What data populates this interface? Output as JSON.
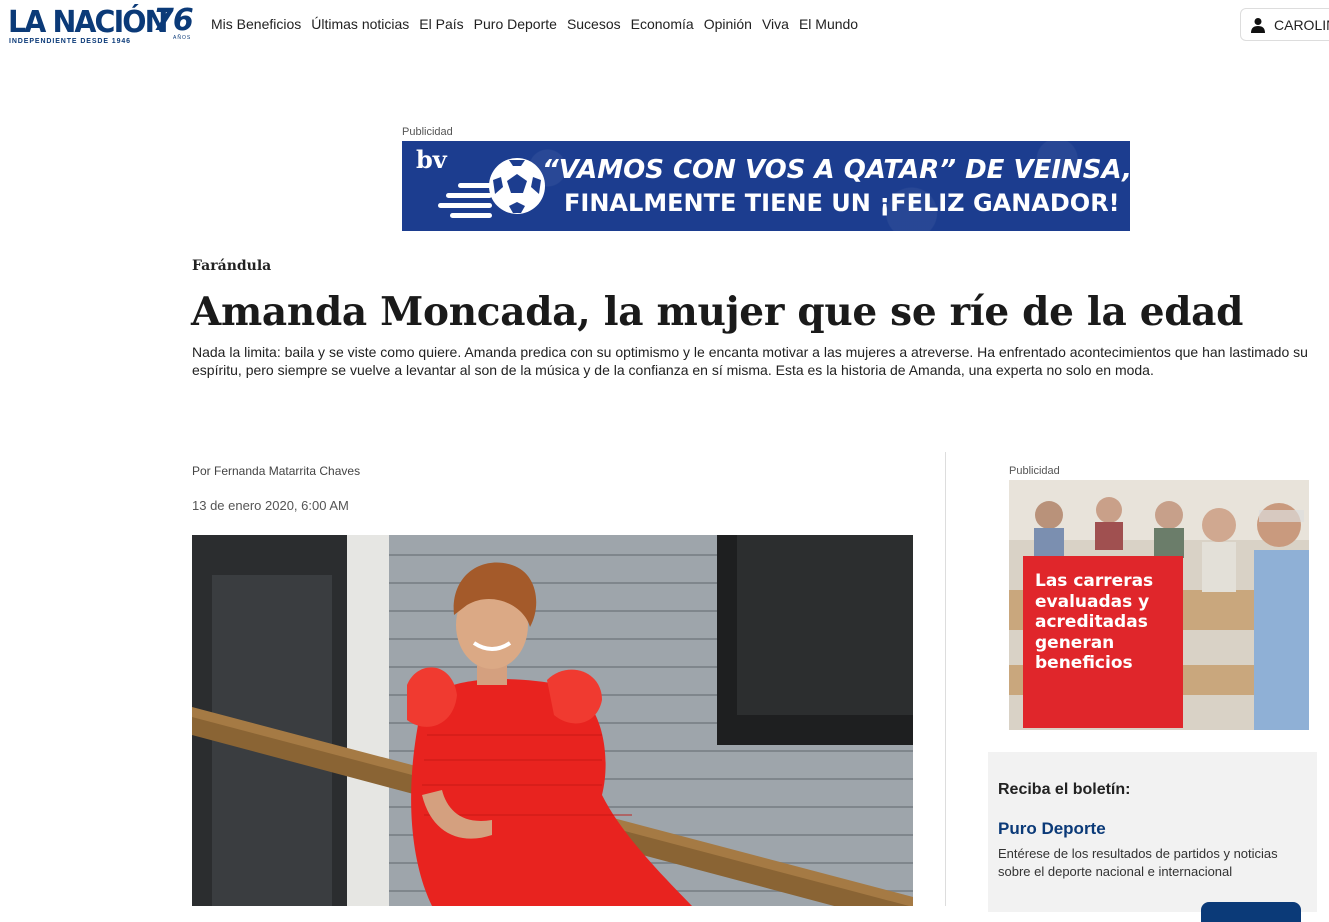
{
  "header": {
    "logo": {
      "brand": "LA NACIÓN",
      "anniversary": "76",
      "years_label": "AÑOS",
      "tagline": "INDEPENDIENTE DESDE 1946"
    },
    "nav": [
      "Mis Beneficios",
      "Últimas noticias",
      "El País",
      "Puro Deporte",
      "Sucesos",
      "Economía",
      "Opinión",
      "Viva",
      "El Mundo"
    ],
    "user": {
      "name": "CAROLIN",
      "icon": "user-icon"
    }
  },
  "top_ad": {
    "label": "Publicidad",
    "brand": "bv",
    "line1": "“VAMOS CON VOS A QATAR” DE VEINSA,",
    "line2": "FINALMENTE TIENE UN ¡FELIZ GANADOR!",
    "colors": {
      "background": "#1c3d8f",
      "text": "#ffffff"
    }
  },
  "article": {
    "section": "Farándula",
    "headline": "Amanda Moncada, la mujer que se ríe de la edad",
    "summary": "Nada la limita: baila y se viste como quiere. Amanda predica con su optimismo y le encanta motivar a las mujeres a atreverse. Ha enfrentado acontecimientos que han lastimado su espíritu, pero siempre se vuelve a levantar al son de la música y de la confianza en sí misma. Esta es la historia de Amanda, una experta no solo en moda.",
    "byline": "Por Fernanda Matarrita Chaves",
    "date": "13 de enero 2020, 6:00 AM"
  },
  "side_ad": {
    "label": "Publicidad",
    "text": "Las carreras evaluadas y acreditadas generan beneficios",
    "colors": {
      "box": "#e0262b"
    }
  },
  "newsletter": {
    "title": "Reciba el boletín:",
    "name": "Puro Deporte",
    "description": "Entérese de los resultados de partidos y noticias sobre el deporte nacional e internacional"
  },
  "colors": {
    "brand": "#0b3a78",
    "accent_red": "#e0262b"
  }
}
